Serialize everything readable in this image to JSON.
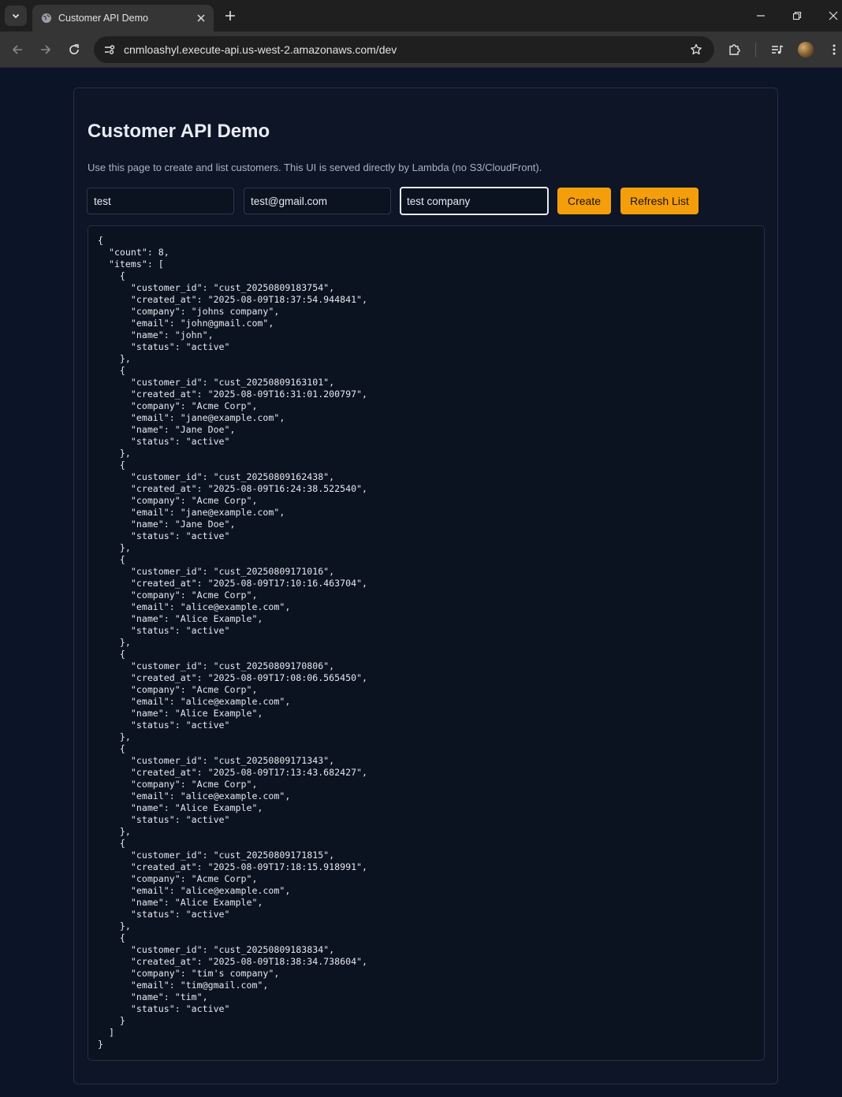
{
  "browser": {
    "tab_title": "Customer API Demo",
    "url": "cnmloashyl.execute-api.us-west-2.amazonaws.com/dev"
  },
  "page": {
    "title": "Customer API Demo",
    "subtitle": "Use this page to create and list customers. This UI is served directly by Lambda (no S3/CloudFront).",
    "form": {
      "name_value": "test",
      "email_value": "test@gmail.com",
      "company_value": "test company",
      "create_label": "Create",
      "refresh_label": "Refresh List"
    }
  },
  "output": {
    "count": 8,
    "items": [
      {
        "customer_id": "cust_20250809183754",
        "created_at": "2025-08-09T18:37:54.944841",
        "company": "johns company",
        "email": "john@gmail.com",
        "name": "john",
        "status": "active"
      },
      {
        "customer_id": "cust_20250809163101",
        "created_at": "2025-08-09T16:31:01.200797",
        "company": "Acme Corp",
        "email": "jane@example.com",
        "name": "Jane Doe",
        "status": "active"
      },
      {
        "customer_id": "cust_20250809162438",
        "created_at": "2025-08-09T16:24:38.522540",
        "company": "Acme Corp",
        "email": "jane@example.com",
        "name": "Jane Doe",
        "status": "active"
      },
      {
        "customer_id": "cust_20250809171016",
        "created_at": "2025-08-09T17:10:16.463704",
        "company": "Acme Corp",
        "email": "alice@example.com",
        "name": "Alice Example",
        "status": "active"
      },
      {
        "customer_id": "cust_20250809170806",
        "created_at": "2025-08-09T17:08:06.565450",
        "company": "Acme Corp",
        "email": "alice@example.com",
        "name": "Alice Example",
        "status": "active"
      },
      {
        "customer_id": "cust_20250809171343",
        "created_at": "2025-08-09T17:13:43.682427",
        "company": "Acme Corp",
        "email": "alice@example.com",
        "name": "Alice Example",
        "status": "active"
      },
      {
        "customer_id": "cust_20250809171815",
        "created_at": "2025-08-09T17:18:15.918991",
        "company": "Acme Corp",
        "email": "alice@example.com",
        "name": "Alice Example",
        "status": "active"
      },
      {
        "customer_id": "cust_20250809183834",
        "created_at": "2025-08-09T18:38:34.738604",
        "company": "tim's company",
        "email": "tim@gmail.com",
        "name": "tim",
        "status": "active"
      }
    ]
  }
}
